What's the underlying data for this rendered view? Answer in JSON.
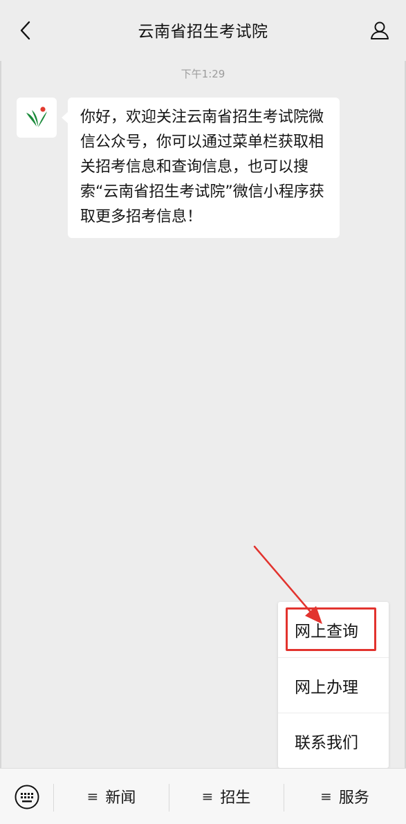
{
  "header": {
    "title": "云南省招生考试院",
    "back_icon": "chevron-left-icon",
    "profile_icon": "person-icon"
  },
  "chat": {
    "timestamp": "下午1:29",
    "message": {
      "avatar_icon": "yunnan-exam-logo",
      "text": "你好，欢迎关注云南省招生考试院微信公众号，你可以通过菜单栏获取相关招考信息和查询信息，也可以搜索“云南省招生考试院”微信小程序获取更多招考信息！"
    }
  },
  "popup_menu": {
    "items": [
      {
        "label": "网上查询",
        "highlighted": true
      },
      {
        "label": "网上办理"
      },
      {
        "label": "联系我们"
      }
    ]
  },
  "annotation": {
    "color": "#e2332e"
  },
  "bottom_menu": {
    "keyboard_icon": "keyboard-icon",
    "tabs": [
      {
        "label": "新闻"
      },
      {
        "label": "招生"
      },
      {
        "label": "服务"
      }
    ]
  },
  "colors": {
    "background": "#ededed",
    "bubble": "#ffffff",
    "logo_green": "#1a8a3a",
    "logo_red": "#e23a2e"
  }
}
